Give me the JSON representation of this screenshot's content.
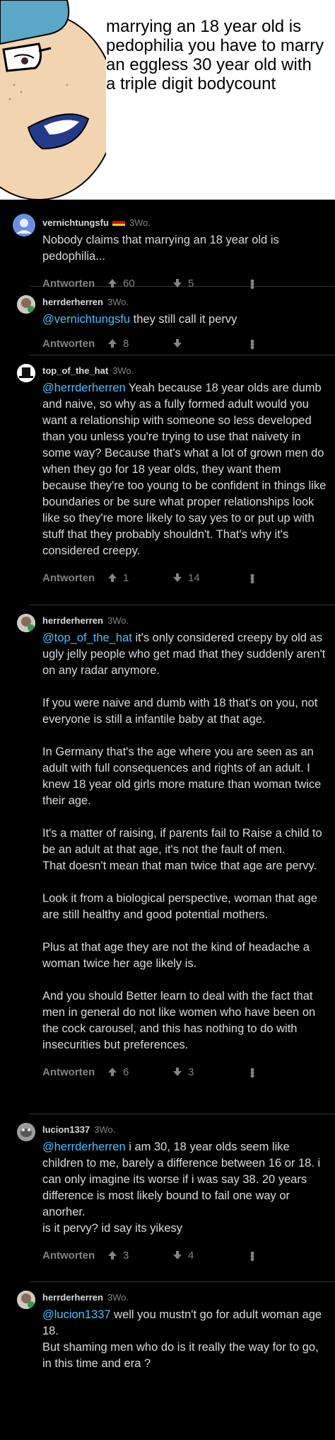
{
  "meme": {
    "caption": "marrying an 18 year old is pedophilia you have to marry an eggless 30 year old with a triple digit bodycount"
  },
  "colors": {
    "background": "#000000",
    "text": "#d7dadc",
    "muted": "#818384",
    "mention": "#4fbcff",
    "divider": "#343536"
  },
  "comments": [
    {
      "username": "vernichtungsfu",
      "has_flag": true,
      "flag": "germany",
      "age": "3Wo.",
      "mention": "",
      "text": "Nobody claims that marrying an 18 year old is pedophilia...",
      "reply_label": "Antworten",
      "upvotes": "60",
      "downvotes": "5",
      "avatar": "default-blue-avatar"
    },
    {
      "username": "herrderherren",
      "age": "3Wo.",
      "mention": "@vernichtungsfu",
      "text": " they still call it pervy",
      "reply_label": "Antworten",
      "upvotes": "8",
      "downvotes": "",
      "avatar": "drawn-avatar-online"
    },
    {
      "username": "top_of_the_hat",
      "age": "3Wo.",
      "mention": "@herrderherren",
      "text": " Yeah because 18 year olds are dumb and naive, so why as a fully formed adult would you want a relationship with someone so less developed than you unless you're trying to use that naivety in some way? Because that's what a lot of grown men do when they go for 18 year olds, they want them because they're too young to be confident in things like boundaries or be sure what proper relationships look like so they're more likely to say yes to or put up with stuff that they probably shouldn't. That's why it's considered creepy.",
      "reply_label": "Antworten",
      "upvotes": "1",
      "downvotes": "14",
      "avatar": "top-hat-avatar"
    },
    {
      "username": "herrderherren",
      "age": "3Wo.",
      "mention": "@top_of_the_hat",
      "text": " it's only considered creepy by old as ugly jelly people who get mad that they suddenly aren't on any radar anymore.\n\nIf you were naive and dumb with 18 that's on you, not everyone is still a infantile baby at that age.\n\nIn Germany that's the age where you are seen as an adult with full consequences and rights of an adult. I knew 18 year old girls more mature than woman twice their age.\n\nIt's a matter of raising, if parents fail to Raise a child to be an adult at that age, it's not the fault of men.\nThat doesn't mean that man twice that age are pervy.\n\nLook it from a biological perspective, woman that age are still healthy and good potential mothers.\n\nPlus at that age they are not the kind of headache a woman twice her age likely is.\n\nAnd you should Better learn to deal with the fact that men in general do not like women who have been on the cock carousel, and this has nothing to do with insecurities but preferences.",
      "reply_label": "Antworten",
      "upvotes": "6",
      "downvotes": "3",
      "avatar": "drawn-avatar-online"
    },
    {
      "username": "lucion1337",
      "age": "3Wo.",
      "mention": "@herrderherren",
      "text": " i am 30, 18 year olds seem like children to me, barely a difference between 16 or 18. i can only imagine its worse if i was say 38. 20 years difference is most likely bound to fail one way or anorher.\nis it pervy? id say its yikesy",
      "reply_label": "Antworten",
      "upvotes": "3",
      "downvotes": "4",
      "avatar": "photo-avatar"
    },
    {
      "username": "herrderherren",
      "age": "3Wo.",
      "mention": "@lucion1337",
      "text": " well you mustn't go for adult woman age 18.\nBut shaming men who do is it really the way for to go, in this time and era ?",
      "reply_label": "",
      "upvotes": "",
      "downvotes": "",
      "avatar": "drawn-avatar-online"
    }
  ]
}
